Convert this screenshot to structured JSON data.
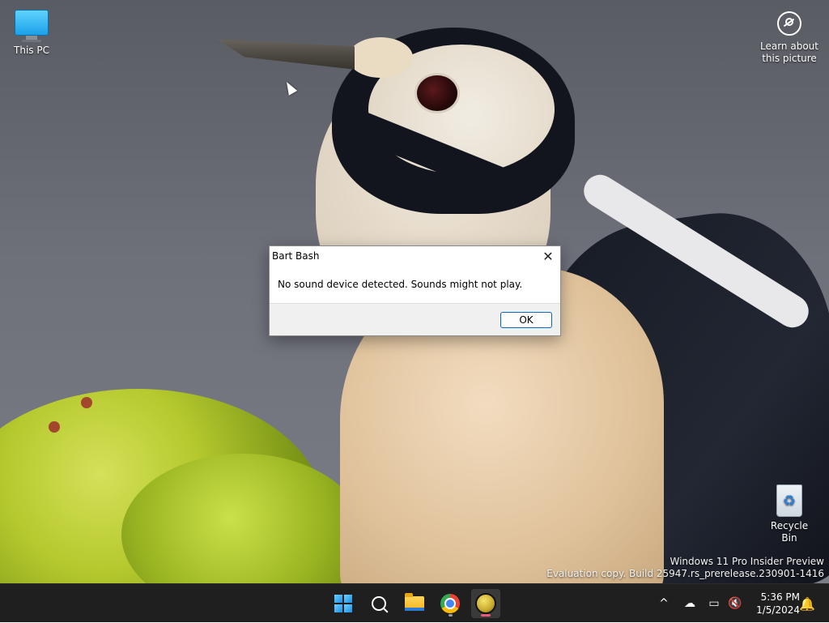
{
  "desktop": {
    "icons": {
      "this_pc": {
        "label": "This PC",
        "icon": "computer-icon"
      },
      "learn": {
        "label_line1": "Learn about",
        "label_line2": "this picture",
        "icon": "learn-icon"
      },
      "recycle_bin": {
        "label": "Recycle Bin",
        "icon": "recycle-bin-icon"
      }
    },
    "watermark": {
      "line1": "Windows 11 Pro Insider Preview",
      "line2": "Evaluation copy. Build 25947.rs_prerelease.230901-1416"
    }
  },
  "dialog": {
    "title": "Bart Bash",
    "close_glyph": "✕",
    "message": "No sound device detected. Sounds might not play.",
    "ok_label": "OK"
  },
  "taskbar": {
    "apps": [
      {
        "name": "start",
        "icon": "windows-logo-icon"
      },
      {
        "name": "search",
        "icon": "search-icon"
      },
      {
        "name": "file-explorer",
        "icon": "folder-icon"
      },
      {
        "name": "chrome",
        "icon": "chrome-icon"
      },
      {
        "name": "bart-bash",
        "icon": "bart-bash-icon",
        "active": true
      }
    ],
    "tray": {
      "chevron": "^",
      "network": "☁",
      "display": "▭",
      "sound": "🔇",
      "notifications": "🔔"
    },
    "clock": {
      "time": "5:36 PM",
      "date": "1/5/2024"
    }
  },
  "colors": {
    "accent": "#0067c0",
    "taskbar_bg": "#1f1f1f",
    "active_indicator": "#e35a7a"
  }
}
